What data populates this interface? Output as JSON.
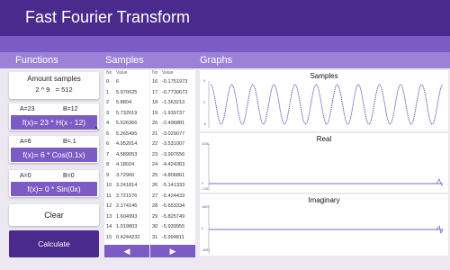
{
  "app": {
    "title": "Fast Fourier Transform"
  },
  "headers": {
    "functions": "Functions",
    "samples": "Samples",
    "graphs": "Graphs"
  },
  "amount": {
    "label": "Amount samples",
    "formula": "2 ^ 9   = 512"
  },
  "functions": [
    {
      "a": "A=23",
      "b": "B=12",
      "formula": "f(x)= 23 * H(x - 12)"
    },
    {
      "a": "A=6",
      "b": "B=.1",
      "formula": "f(x)= 6 * Cos(0.1x)"
    },
    {
      "a": "A=0",
      "b": "B=0",
      "formula": "f(x)= 0 * Sin(0x)"
    }
  ],
  "buttons": {
    "clear": "Clear",
    "calculate": "Calculate",
    "prev": "◀",
    "next": "▶"
  },
  "samples_table": {
    "col_no": "No",
    "col_value": "Value",
    "left": [
      [
        "0",
        "6"
      ],
      [
        "1",
        "5.970025"
      ],
      [
        "2",
        "5.8804"
      ],
      [
        "3",
        "5.732019"
      ],
      [
        "4",
        "5.526366"
      ],
      [
        "5",
        "5.265495"
      ],
      [
        "6",
        "4.952014"
      ],
      [
        "7",
        "4.589053"
      ],
      [
        "8",
        "4.18024"
      ],
      [
        "9",
        "3.72966"
      ],
      [
        "10",
        "3.241814"
      ],
      [
        "11",
        "2.721576"
      ],
      [
        "12",
        "2.174146"
      ],
      [
        "13",
        "1.604993"
      ],
      [
        "14",
        "1.019803"
      ],
      [
        "15",
        "0.4244232"
      ]
    ],
    "right": [
      [
        "16",
        "-0.1751973"
      ],
      [
        "17",
        "-0.7730672"
      ],
      [
        "18",
        "-1.363213"
      ],
      [
        "19",
        "-1.939737"
      ],
      [
        "20",
        "-2.496881"
      ],
      [
        "21",
        "-3.029077"
      ],
      [
        "22",
        "-3.531007"
      ],
      [
        "23",
        "-3.997656"
      ],
      [
        "24",
        "-4.424363"
      ],
      [
        "25",
        "-4.806861"
      ],
      [
        "26",
        "-5.141333"
      ],
      [
        "27",
        "-5.424433"
      ],
      [
        "28",
        "-5.653334"
      ],
      [
        "29",
        "-5.825749"
      ],
      [
        "30",
        "-5.939955"
      ],
      [
        "31",
        "-5.994811"
      ]
    ]
  },
  "graphs": {
    "samples": {
      "title": "Samples",
      "ytick_top": "6",
      "ytick_mid": "0",
      "ytick_bot": "-6"
    },
    "real": {
      "title": "Real",
      "ytick_top": "1536",
      "ytick_mid": "0",
      "ytick_bot": "-216"
    },
    "imaginary": {
      "title": "Imaginary",
      "ytick_top": "1661",
      "ytick_mid": "0",
      "ytick_bot": "-1661"
    }
  },
  "colors": {
    "title_bar": "#4a2a8c",
    "band": "#7d5bc4",
    "header": "#9b82d8",
    "accent": "#7d5bc4",
    "trace": "#5a3aa8"
  }
}
